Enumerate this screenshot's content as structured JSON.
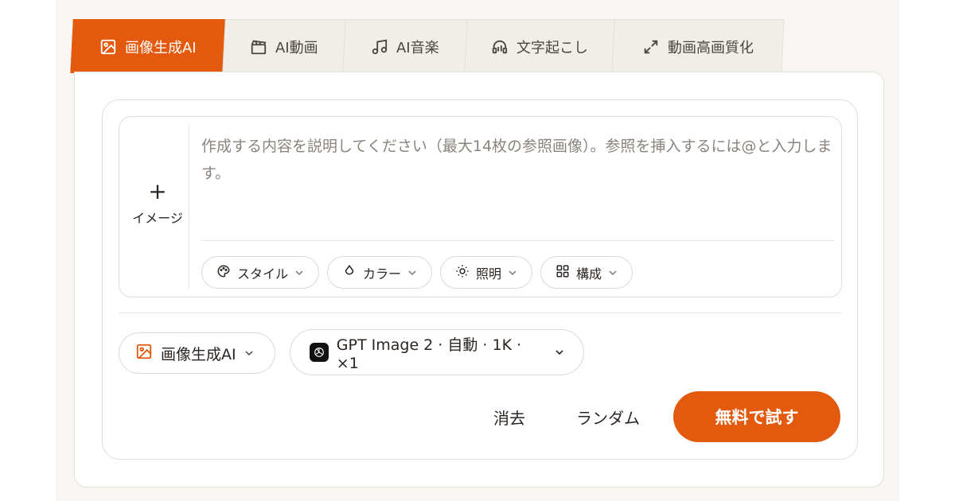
{
  "tabs": [
    {
      "label": "画像生成AI",
      "icon": "image-icon",
      "active": true
    },
    {
      "label": "AI動画",
      "icon": "clapperboard-icon",
      "active": false
    },
    {
      "label": "AI音楽",
      "icon": "music-note-icon",
      "active": false
    },
    {
      "label": "文字起こし",
      "icon": "audio-lines-icon",
      "active": false
    },
    {
      "label": "動画高画質化",
      "icon": "expand-icon",
      "active": false
    }
  ],
  "prompt": {
    "add_image_symbol": "+",
    "add_image_label": "イメージ",
    "placeholder": "作成する内容を説明してください（最大14枚の参照画像）。参照を挿入するには@と入力します。"
  },
  "chips": [
    {
      "label": "スタイル",
      "icon": "palette-icon"
    },
    {
      "label": "カラー",
      "icon": "droplet-icon"
    },
    {
      "label": "照明",
      "icon": "sun-icon"
    },
    {
      "label": "構成",
      "icon": "grid-icon"
    }
  ],
  "mode_selector": {
    "label": "画像生成AI",
    "icon": "image-icon"
  },
  "model_selector": {
    "label": "GPT Image 2 · 自動 · 1K · ×1",
    "icon": "openai-logo-icon"
  },
  "actions": {
    "clear": "消去",
    "random": "ランダム",
    "submit": "無料で試す"
  },
  "colors": {
    "accent": "#e35a0e"
  }
}
